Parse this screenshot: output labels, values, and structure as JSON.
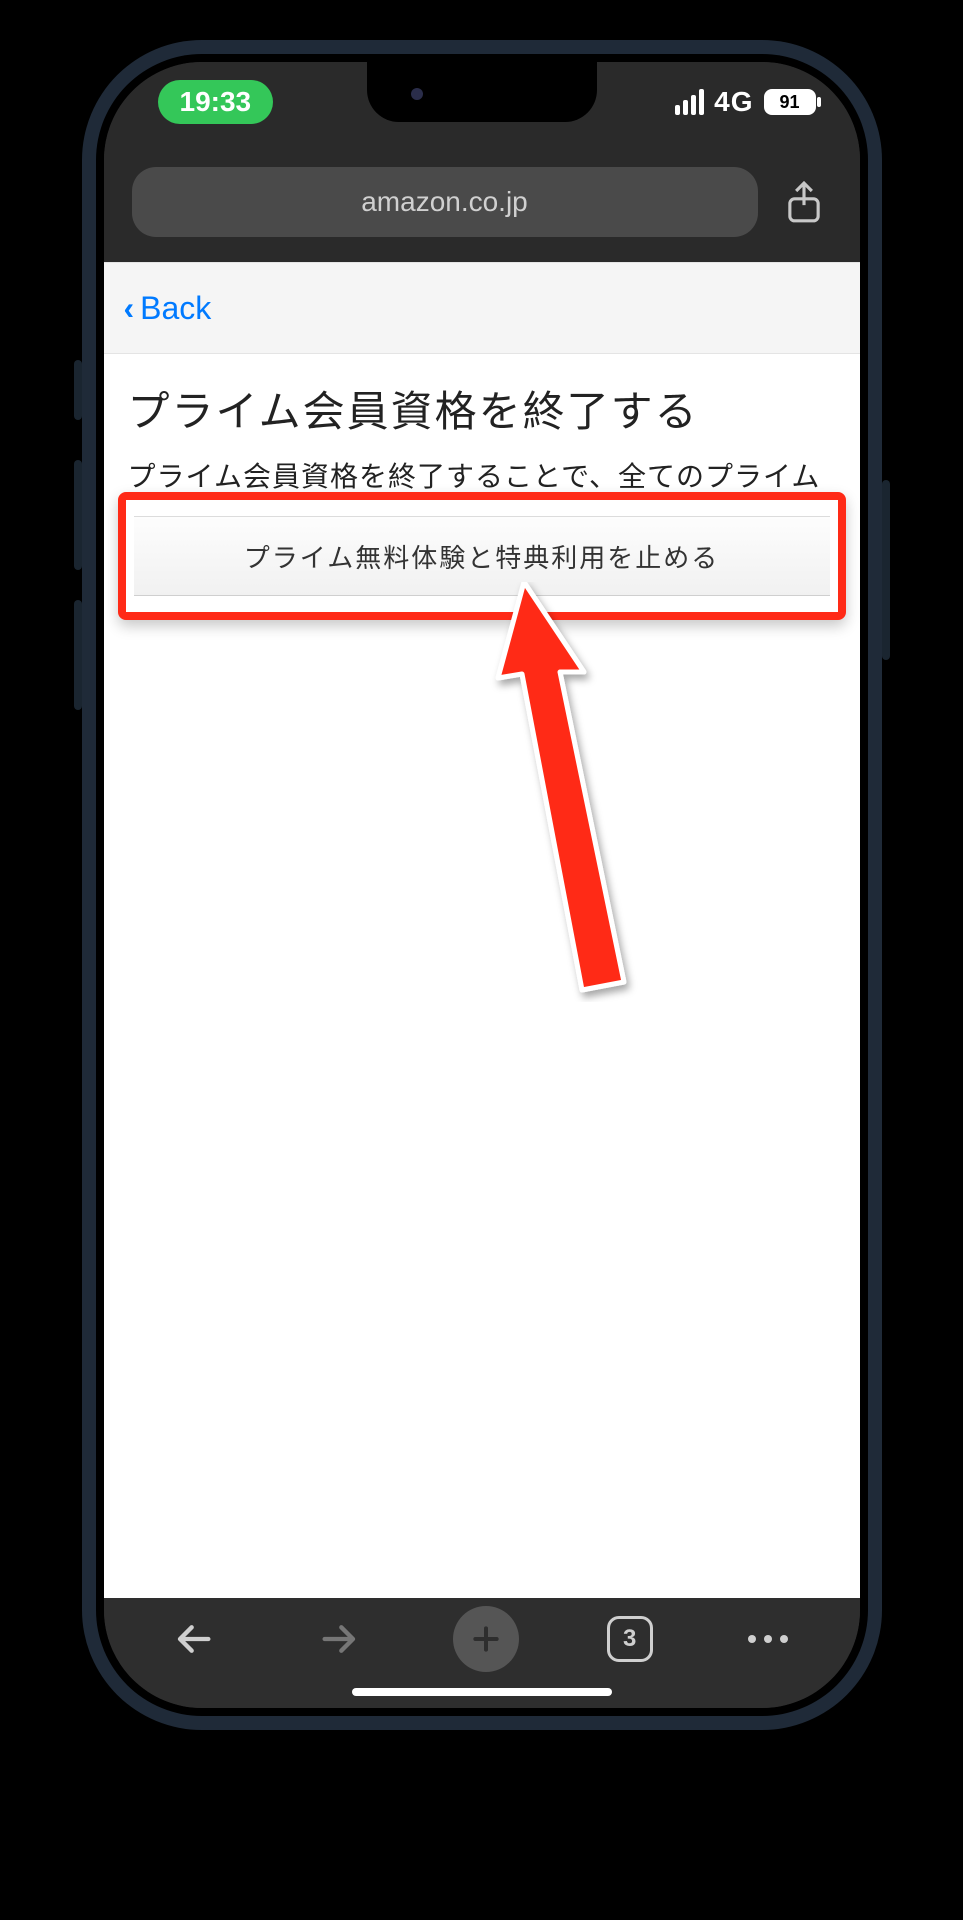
{
  "status": {
    "time": "19:33",
    "network_label": "4G",
    "battery_pct": "91"
  },
  "browser": {
    "url_display": "amazon.co.jp",
    "tab_count": "3"
  },
  "page": {
    "back_label": "Back",
    "title": "プライム会員資格を終了する",
    "description": "プライム会員資格を終了することで、全てのプライム",
    "stop_button_label": "プライム無料体験と特典利用を止める"
  },
  "annotation": {
    "highlight_color": "#ff2a17"
  }
}
